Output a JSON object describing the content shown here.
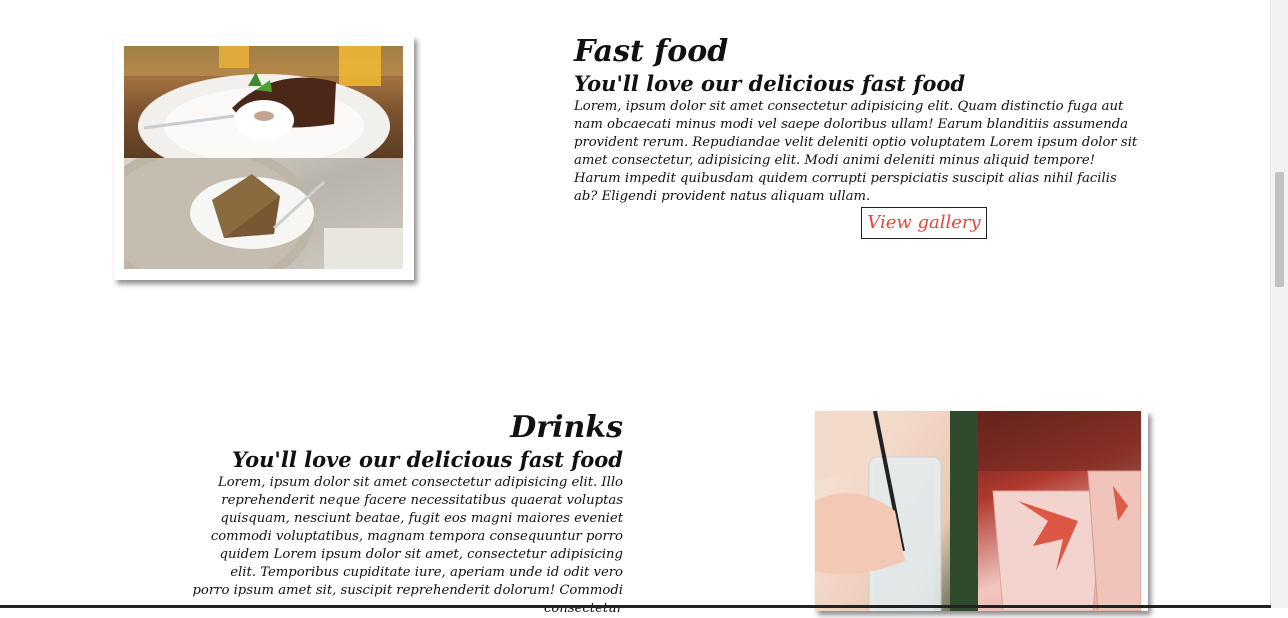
{
  "section1": {
    "title": "Fast food",
    "subtitle": "You'll love our delicious fast food",
    "body": "Lorem, ipsum dolor sit amet consectetur adipisicing elit. Quam distinctio fuga aut nam obcaecati minus modi vel saepe doloribus ullam! Earum blanditiis assumenda provident rerum. Repudiandae velit deleniti optio voluptatem Lorem ipsum dolor sit amet consectetur, adipisicing elit. Modi animi deleniti minus aliquid tempore! Harum impedit quibusdam quidem corrupti perspiciatis suscipit alias nihil facilis ab? Eligendi provident natus aliquam ullam.",
    "button_label": "View gallery"
  },
  "section2": {
    "title": "Drinks",
    "subtitle": "You'll love our delicious fast food",
    "body": "Lorem, ipsum dolor sit amet consectetur adipisicing elit. Illo reprehenderit neque facere necessitatibus quaerat voluptas quisquam, nesciunt beatae, fugit eos magni maiores eveniet commodi voluptatibus, magnam tempora consequuntur porro quidem Lorem ipsum dolor sit amet, consectetur adipisicing elit. Temporibus cupiditate iure, aperiam unde id odit vero porro ipsum amet sit, suscipit reprehenderit dolorum! Commodi consectetur"
  },
  "colors": {
    "accent": "#e4473c",
    "text": "#111111",
    "background": "#ffffff"
  }
}
